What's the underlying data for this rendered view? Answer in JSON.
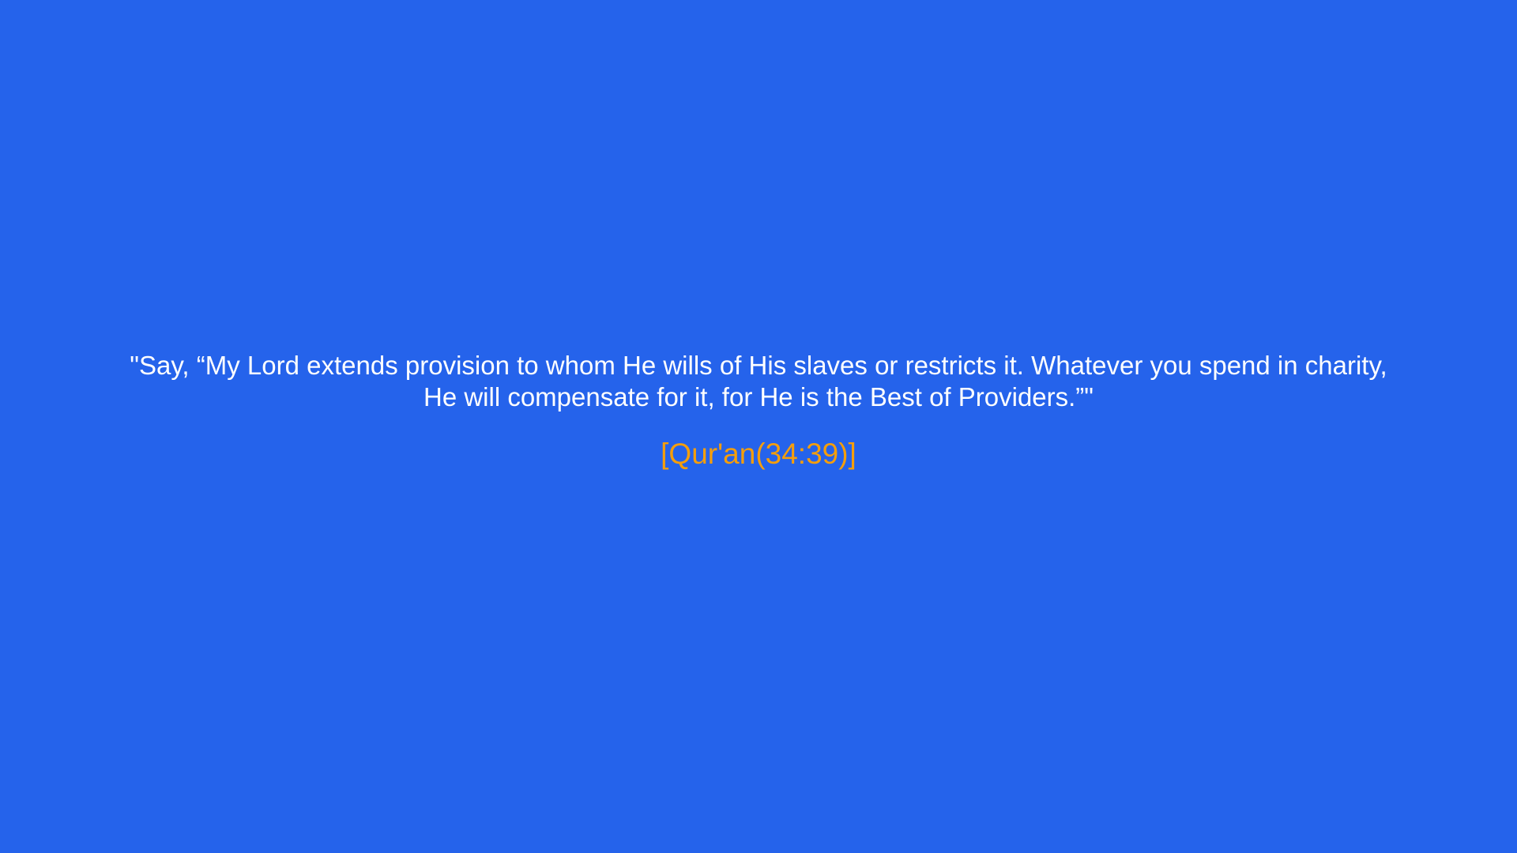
{
  "quote": {
    "text": "\"Say, “My Lord extends provision to whom He wills of His slaves or restricts it. Whatever you spend in charity, He will compensate for it, for He is the Best of Providers.”\"",
    "reference": "[Qur'an(34:39)]"
  },
  "colors": {
    "background": "#2563EB",
    "text": "#FFFFFF",
    "reference": "#F59E0B"
  }
}
